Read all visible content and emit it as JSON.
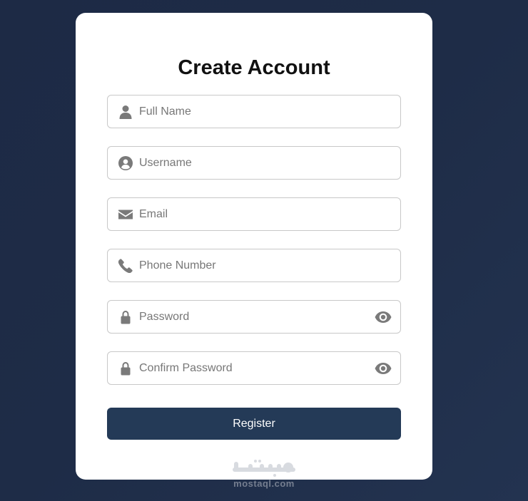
{
  "form": {
    "title": "Create Account",
    "fields": [
      {
        "id": "full-name",
        "placeholder": "Full Name",
        "value": "",
        "icon": "user-icon"
      },
      {
        "id": "username",
        "placeholder": "Username",
        "value": "",
        "icon": "user-circle-icon"
      },
      {
        "id": "email",
        "placeholder": "Email",
        "value": "",
        "icon": "envelope-icon"
      },
      {
        "id": "phone",
        "placeholder": "Phone Number",
        "value": "",
        "icon": "phone-icon"
      },
      {
        "id": "password",
        "placeholder": "Password",
        "value": "",
        "icon": "lock-icon",
        "toggle_icon": "eye-icon"
      },
      {
        "id": "confirm-password",
        "placeholder": "Confirm Password",
        "value": "",
        "icon": "lock-icon",
        "toggle_icon": "eye-icon"
      }
    ],
    "submit_label": "Register"
  },
  "watermark": {
    "text": "mostaql.com",
    "arabic_logo": "مستقل"
  },
  "colors": {
    "background": "#1e2c47",
    "card": "#ffffff",
    "button": "#243a57",
    "icon": "#7a7a7a"
  }
}
